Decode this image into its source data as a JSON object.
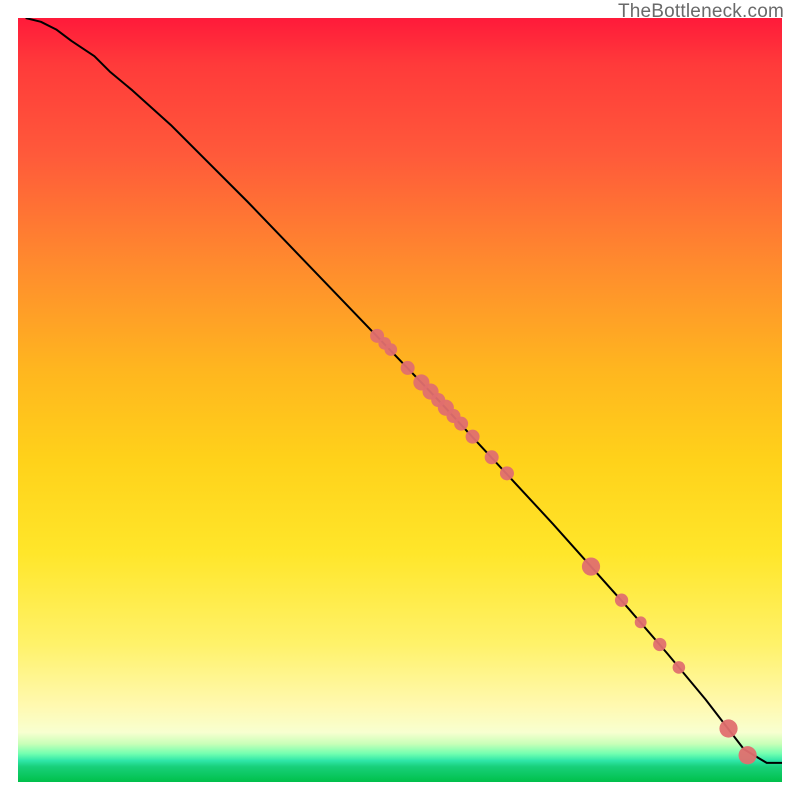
{
  "watermark": "TheBottleneck.com",
  "colors": {
    "curve": "#000000",
    "point_fill": "#e06f6f",
    "point_stroke": "#e06f6f",
    "background_border": "#000000"
  },
  "chart_data": {
    "type": "line",
    "title": "",
    "xlabel": "",
    "ylabel": "",
    "xlim": [
      0,
      100
    ],
    "ylim": [
      0,
      100
    ],
    "grid": false,
    "series": [
      {
        "name": "curve",
        "x": [
          1,
          3,
          5,
          7,
          10,
          12,
          15,
          20,
          25,
          30,
          35,
          40,
          45,
          50,
          55,
          60,
          65,
          70,
          75,
          80,
          85,
          90,
          95,
          98,
          100
        ],
        "y": [
          100,
          99.5,
          98.5,
          97,
          95,
          93,
          90.5,
          86,
          81,
          76,
          70.8,
          65.6,
          60.4,
          55.2,
          50,
          44.6,
          39.2,
          33.8,
          28.2,
          22.6,
          16.8,
          10.8,
          4.3,
          2.5,
          2.5
        ]
      }
    ],
    "points": {
      "name": "markers",
      "radius_scale": 7,
      "x": [
        47,
        48,
        48.8,
        51,
        52.8,
        54,
        55,
        56,
        57,
        58,
        59.5,
        62,
        64,
        75,
        79,
        81.5,
        84,
        86.5,
        93,
        95.5
      ],
      "y": [
        58.4,
        57.4,
        56.6,
        54.2,
        52.3,
        51.1,
        50.0,
        49.0,
        47.9,
        46.9,
        45.2,
        42.5,
        40.4,
        28.2,
        23.8,
        20.9,
        18.0,
        15.0,
        7.0,
        3.5
      ],
      "r": [
        1.0,
        0.9,
        0.9,
        1.0,
        1.15,
        1.15,
        1.0,
        1.15,
        1.0,
        1.0,
        1.0,
        1.0,
        1.0,
        1.3,
        0.95,
        0.85,
        0.95,
        0.9,
        1.3,
        1.3
      ]
    }
  }
}
